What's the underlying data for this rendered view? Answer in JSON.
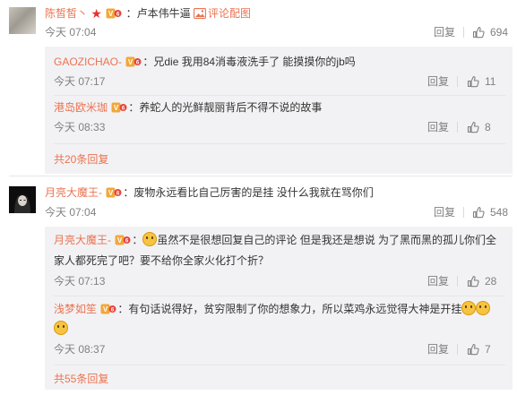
{
  "labels": {
    "reply": "回复",
    "sep_colon": "："
  },
  "comments": [
    {
      "author": "陈皙皙丶",
      "text": "卢本伟牛逼",
      "pic_label": "评论配图",
      "time": "今天 07:04",
      "likes": "694",
      "replies": [
        {
          "author": "GAOZICHAO-",
          "text": "兄die 我用84消毒液洗手了 能摸摸你的jb吗",
          "time": "今天 07:17",
          "likes": "11"
        },
        {
          "author": "港岛欧米珈",
          "text": "养蛇人的光鲜靓丽背后不得不说的故事",
          "time": "今天 08:33",
          "likes": "8"
        }
      ],
      "more": "共20条回复"
    },
    {
      "author": "月亮大魔王-",
      "text": "废物永远看比自己厉害的是挂  没什么我就在骂你们",
      "time": "今天 07:04",
      "likes": "548",
      "replies": [
        {
          "author": "月亮大魔王-",
          "text_line1": "虽然不是很想回复自己的评论 但是我还是想说 为了黑而黑的孤儿你们全",
          "text_line2": "家人都死完了吧？要不给你全家火化打个折？",
          "time": "今天 07:13",
          "likes": "28"
        },
        {
          "author": "浅梦如笙",
          "text": "有句话说得好，贫穷限制了你的想象力，所以菜鸡永远觉得大神是开挂",
          "time": "今天 08:37",
          "likes": "7"
        }
      ],
      "more": "共55条回复"
    }
  ],
  "colors": {
    "name": "#eb7350",
    "meta": "#808080",
    "reply_bg": "#f2f2f5"
  },
  "icons": [
    "vip-badge-icon",
    "star-icon",
    "image-icon",
    "thumb-up-icon",
    "grin-emoji-icon",
    "smirk-emoji-icon"
  ]
}
